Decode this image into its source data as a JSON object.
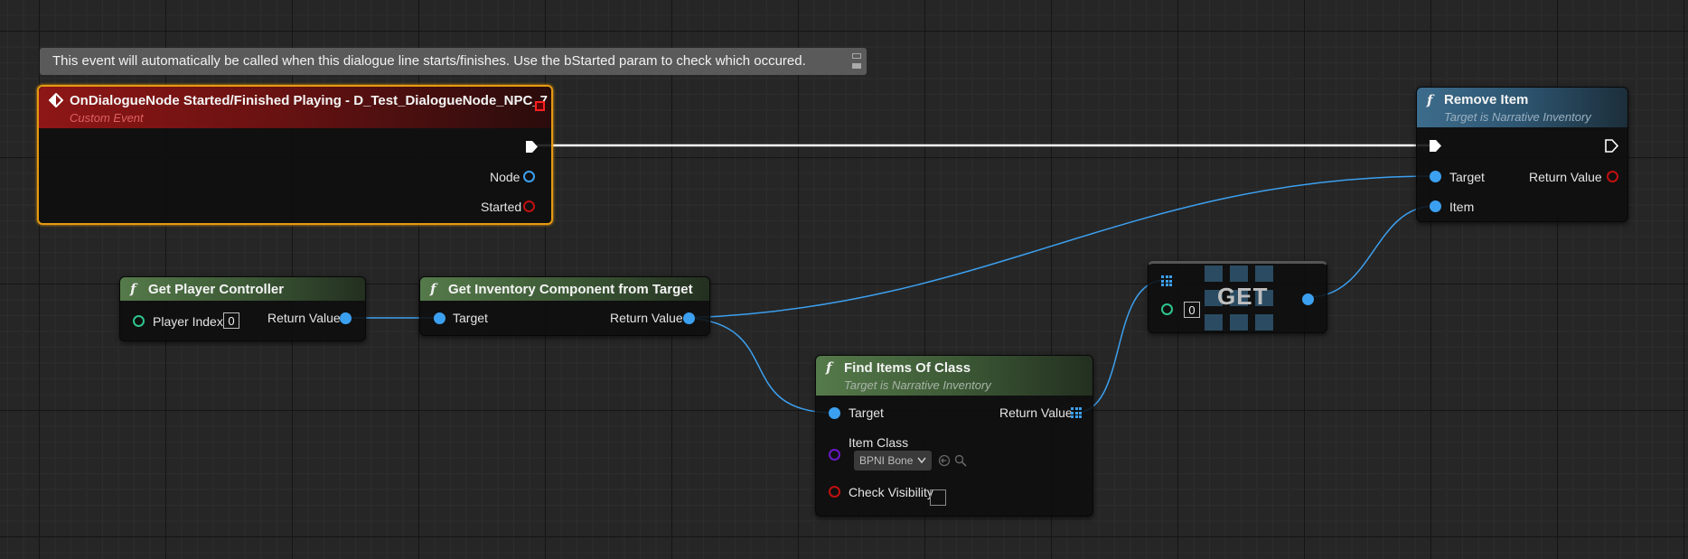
{
  "comment": {
    "text": "This event will automatically be called when this dialogue line starts/finishes. Use the bStarted param to check which occured."
  },
  "event_node": {
    "title": "OnDialogueNode Started/Finished Playing - D_Test_DialogueNode_NPC_7",
    "subtitle": "Custom Event",
    "pins": {
      "node": "Node",
      "started": "Started"
    }
  },
  "remove_item": {
    "icon": "f",
    "title": "Remove Item",
    "subtitle": "Target is Narrative Inventory",
    "pins": {
      "target": "Target",
      "item": "Item",
      "return_value": "Return Value"
    }
  },
  "get_player_controller": {
    "icon": "f",
    "title": "Get Player Controller",
    "pins": {
      "player_index": "Player Index",
      "player_index_value": "0",
      "return_value": "Return Value"
    }
  },
  "get_inventory": {
    "icon": "f",
    "title": "Get Inventory Component from Target",
    "pins": {
      "target": "Target",
      "return_value": "Return Value"
    }
  },
  "find_items": {
    "icon": "f",
    "title": "Find Items Of Class",
    "subtitle": "Target is Narrative Inventory",
    "pins": {
      "target": "Target",
      "return_value": "Return Value",
      "item_class": "Item Class",
      "item_class_value": "BPNI Bone",
      "check_visibility": "Check Visibility"
    }
  },
  "get_node": {
    "title": "GET",
    "index_value": "0"
  },
  "colors": {
    "exec": "#ffffff",
    "object": "#3ca0f0",
    "bool": "#c11010",
    "int": "#2ec48c",
    "class": "#6a18c8",
    "selection": "#e59a12"
  }
}
